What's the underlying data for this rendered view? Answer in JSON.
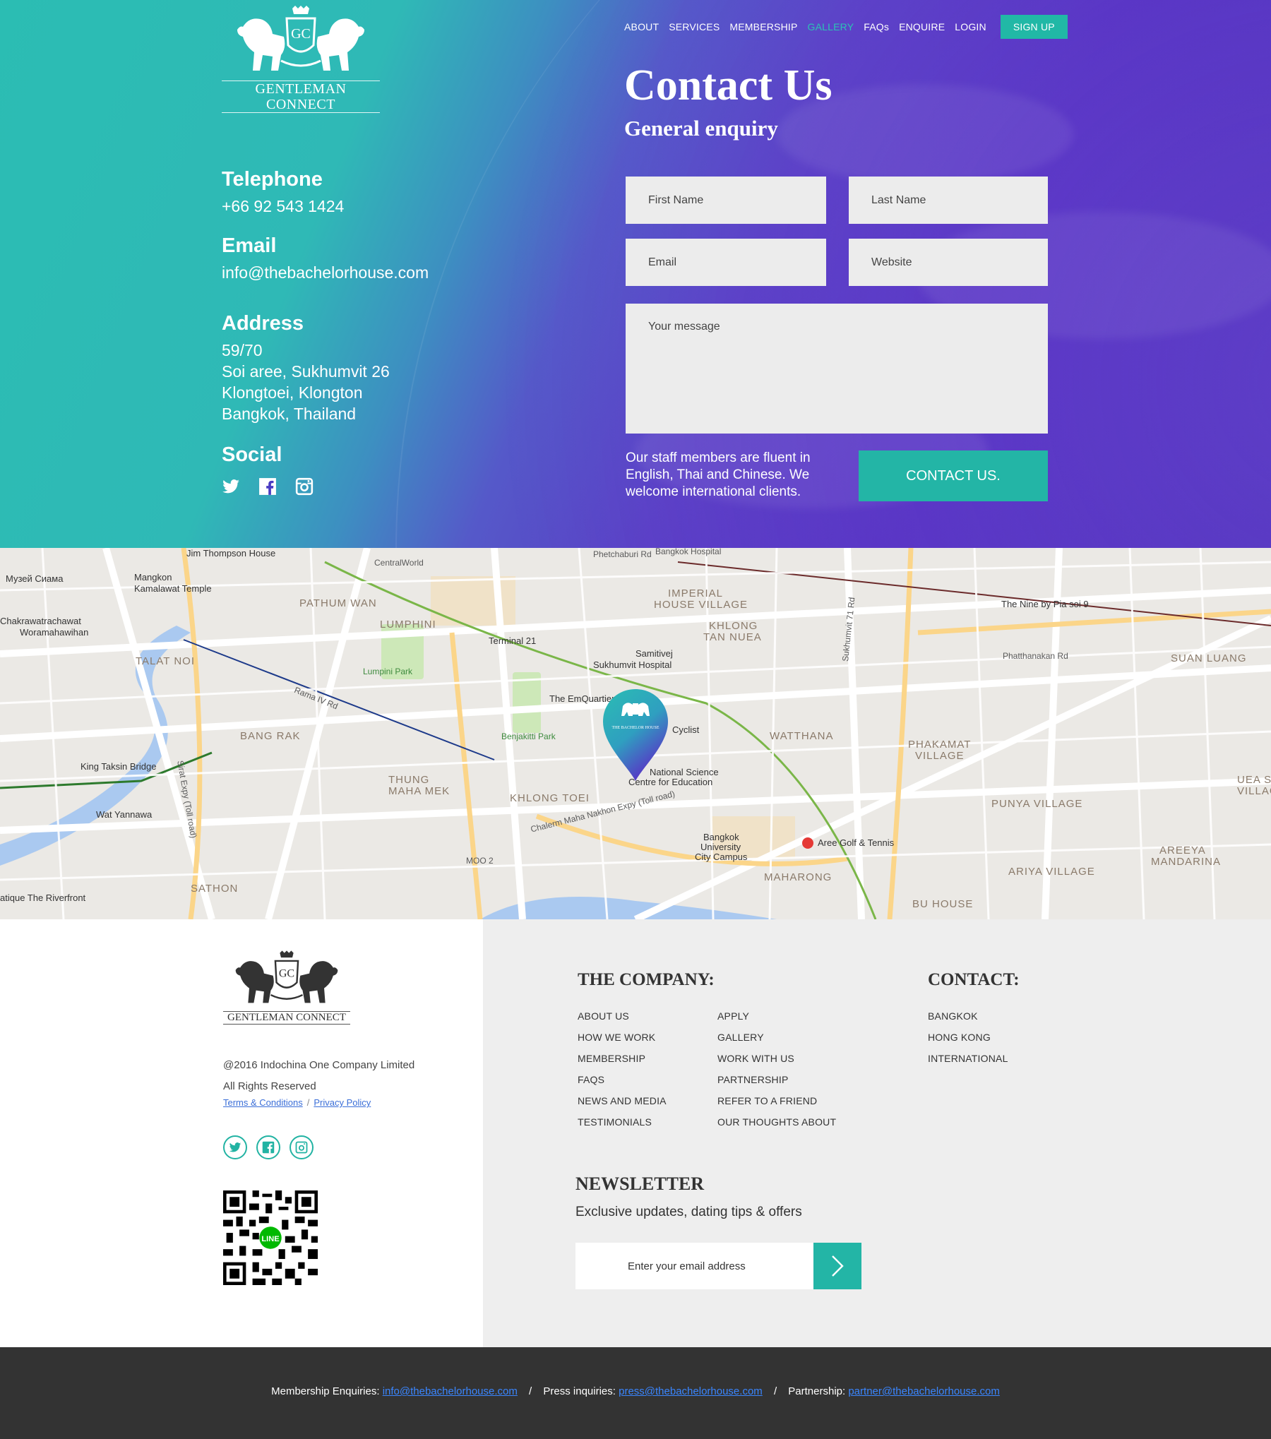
{
  "brand": {
    "name": "GENTLEMAN CONNECT",
    "monogram": "GC"
  },
  "nav": {
    "items": [
      {
        "label": "ABOUT",
        "name": "nav-about",
        "active": false
      },
      {
        "label": "SERVICES",
        "name": "nav-services",
        "active": false
      },
      {
        "label": "MEMBERSHIP",
        "name": "nav-membership",
        "active": false
      },
      {
        "label": "GALLERY",
        "name": "nav-gallery",
        "active": true
      },
      {
        "label": "FAQs",
        "name": "nav-faqs",
        "active": false
      },
      {
        "label": "ENQUIRE",
        "name": "nav-enquire",
        "active": false
      },
      {
        "label": "LOGIN",
        "name": "nav-login",
        "active": false
      }
    ],
    "signup_label": "SIGN UP"
  },
  "hero": {
    "title": "Contact Us",
    "subtitle": "General enquiry"
  },
  "contact_info": {
    "telephone_heading": "Telephone",
    "telephone": "+66 92 543 1424",
    "email_heading": "Email",
    "email": "info@thebachelorhouse.com",
    "address_heading": "Address",
    "address_lines": [
      "59/70",
      "Soi aree, Sukhumvit 26",
      "Klongtoei, Klongton",
      "Bangkok, Thailand"
    ],
    "social_heading": "Social",
    "social_icons": [
      "twitter-icon",
      "facebook-icon",
      "instagram-icon"
    ]
  },
  "form": {
    "first_name_placeholder": "First Name",
    "last_name_placeholder": "Last Name",
    "email_placeholder": "Email",
    "website_placeholder": "Website",
    "message_placeholder": "Your message",
    "note": "Our staff members are fluent in English, Thai and Chinese. We welcome international clients.",
    "submit_label": "CONTACT US."
  },
  "map": {
    "labels": [
      "Jim Thompson House",
      "CentralWorld",
      "Mangkon",
      "Kamalawat Temple",
      "PATHUM WAN",
      "LUMPHINI",
      "Lumpini Park",
      "Terminal 21",
      "Samitivej",
      "Sukhumvit Hospital",
      "The EmQuartier",
      "Benjakitti Park",
      "IMPERIAL",
      "HOUSE VILLAGE",
      "KHLONG",
      "TAN NUEA",
      "WATTHANA",
      "PHAKAMAT",
      "VILLAGE",
      "SUAN LUANG",
      "The Nine by Pia soi 9",
      "Phatthanakan Rd",
      "BANG RAK",
      "TALAT NOI",
      "King Taksin Bridge",
      "Wat Yannawa",
      "THUNG",
      "MAHA MEK",
      "KHLONG TOEI",
      "Cyclist",
      "National Science",
      "Centre for Education",
      "Bangkok",
      "University",
      "City Campus",
      "Aree Golf & Tennis",
      "MAHARONG",
      "PUNYA VILLAGE",
      "ARIYA VILLAGE",
      "AREEYA",
      "MANDARINA",
      "BU HOUSE",
      "SATHON",
      "MOO 2",
      "Chalerm Maha Nakhon Expy (Toll road)",
      "Sirat Expy (Toll road)",
      "Rama IV Rd",
      "Phetchaburi Rd",
      "Sukhumvit 71 Rd",
      "Chakrawatrachawat",
      "Woramahawihan",
      "atique The Riverfront",
      "Музей Сиама",
      "Bangkok Hospital",
      "UEA SU",
      "VILLAG"
    ],
    "pin_label": "THE BACHELOR HOUSE"
  },
  "footer": {
    "copyright": "@2016 Indochina One Company Limited",
    "rights": "All Rights Reserved",
    "terms_label": "Terms & Conditions",
    "separator": "/",
    "privacy_label": "Privacy Policy",
    "social_icons": [
      "twitter-icon",
      "facebook-icon",
      "instagram-icon"
    ],
    "qr_label": "LINE",
    "company_title": "THE COMPANY:",
    "company_links_col1": [
      "ABOUT US",
      "HOW WE WORK",
      "MEMBERSHIP",
      "FAQS",
      "NEWS AND MEDIA",
      "TESTIMONIALS"
    ],
    "company_links_col2": [
      "APPLY",
      "GALLERY",
      "WORK WITH US",
      "PARTNERSHIP",
      "REFER TO A FRIEND",
      "OUR THOUGHTS ABOUT"
    ],
    "contact_title": "CONTACT:",
    "contact_links": [
      "BANGKOK",
      "HONG KONG",
      "INTERNATIONAL"
    ],
    "newsletter_title": "NEWSLETTER",
    "newsletter_sub": "Exclusive updates, dating tips & offers",
    "newsletter_placeholder": "Enter your email address"
  },
  "bottom": {
    "membership_label": "Membership Enquiries:",
    "membership_email": "info@thebachelorhouse.com",
    "press_label": "Press inquiries:",
    "press_email": "press@thebachelorhouse.com",
    "partnership_label": "Partnership:",
    "partnership_email": "partner@thebachelorhouse.com",
    "slash": "/"
  },
  "colors": {
    "teal": "#23b5a6",
    "purple": "#5530c2",
    "dark": "#333333",
    "link": "#3a6ed8"
  }
}
